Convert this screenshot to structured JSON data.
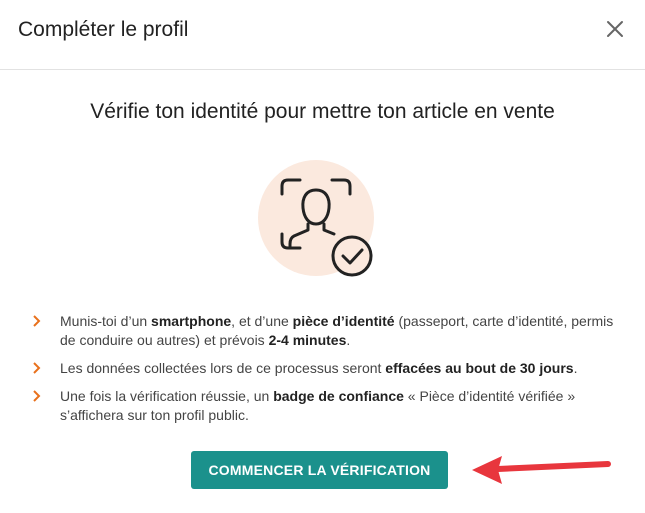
{
  "header": {
    "title": "Compléter le profil",
    "close_icon": "close-icon"
  },
  "main": {
    "title": "Vérifie ton identité pour mettre ton article en vente",
    "illustration_icon": "face-id-verified-icon"
  },
  "items": [
    {
      "parts": [
        "Munis-toi d’un ",
        "smartphone",
        ", et d’une ",
        "pièce d’identité",
        " (passeport, carte d’identité, permis de conduire ou autres) et prévois ",
        "2-4 minutes",
        "."
      ]
    },
    {
      "parts": [
        "Les données collectées lors de ce processus seront ",
        "effacées au bout de 30 jours",
        "."
      ]
    },
    {
      "parts": [
        "Une fois la vérification réussie, un ",
        "badge de confiance",
        " « Pièce d’identité vérifiée » s’affichera sur ton profil public."
      ]
    }
  ],
  "cta": {
    "label": "COMMENCER LA VÉRIFICATION"
  },
  "colors": {
    "accent": "#1b918c",
    "chevron": "#e8711c",
    "arrow": "#e8363d",
    "illustration_bg": "#fbe9de"
  }
}
